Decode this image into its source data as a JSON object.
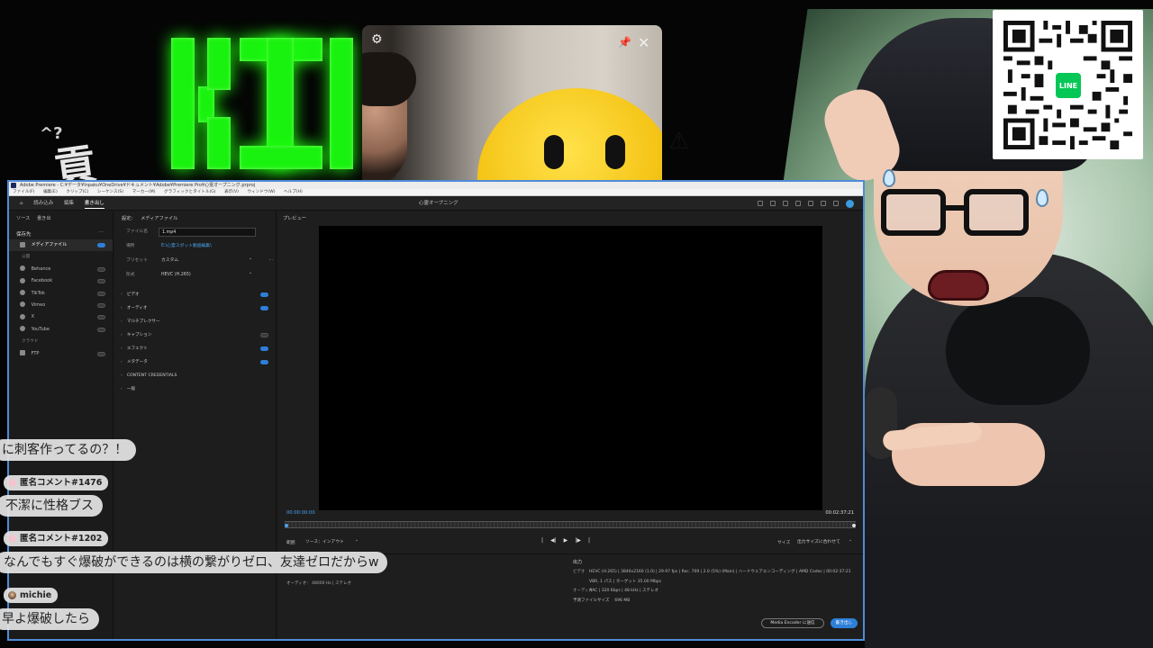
{
  "premiere": {
    "title_bar": "Adobe Premiere - C:¥データ¥Inpaku¥OneDrive¥ドキュメント¥Adobe¥Premiere Pro¥心霊オープニング.prproj",
    "menu": [
      "ファイル(F)",
      "編集(E)",
      "クリップ(C)",
      "シーケンス(S)",
      "マーカー(M)",
      "グラフィックとタイトル(G)",
      "表示(V)",
      "ウィンドウ(W)",
      "ヘルプ(H)"
    ],
    "nav": {
      "home": "⌂",
      "import": "読み込み",
      "edit": "編集",
      "export": "書き出し"
    },
    "project_name": "心霊オープニング",
    "left": {
      "source_label": "ソース",
      "source_value": "書き出",
      "destinations_label": "保存先",
      "media_file": "メディアファイル",
      "public_label": "公開",
      "platforms": [
        "Behance",
        "Facebook",
        "TikTok",
        "Vimeo",
        "X",
        "YouTube"
      ],
      "cloud_label": "クラウド",
      "ftp": "FTP"
    },
    "settings": {
      "header": "設定：",
      "header_sub": "メディアファイル",
      "file_label": "ファイル名",
      "file_value": "1.mp4",
      "location_label": "場所",
      "location_value": "E:\\心霊スポット動画編集\\",
      "preset_label": "プリセット",
      "preset_value": "カスタム",
      "format_label": "形式",
      "format_value": "HEVC (H.265)",
      "sections": [
        "ビデオ",
        "オーディオ",
        "マルチプレクサー",
        "キャプション",
        "エフェクト",
        "メタデータ",
        "CONTENT CREDENTIALS",
        "一般"
      ]
    },
    "preview": {
      "header": "プレビュー",
      "timecode_in": "00:00:00:00",
      "timecode_out": "00:02:37:21",
      "range_label": "範囲",
      "range_value": "ソース：インアウト",
      "transport": [
        "|",
        "◀|",
        "▶",
        "|▶",
        "|"
      ],
      "scale_label": "サイズ",
      "scale_value": "出力サイズに合わせて",
      "summary_label": "出力",
      "summary": [
        {
          "key": "ビデオ",
          "value": "HEVC (H.265) | 3840x2160 (1.0) | 29.97 fps | Rec. 709 | 2.0 (5%) (Main) | ハードウェアエンコーディング | AMD Codec | 00:02:37:21"
        },
        {
          "key": "",
          "value": "VBR, 1 パス | ターゲット 35.00 Mbps"
        },
        {
          "key": "オーディオ",
          "value": "AAC | 320 Kbps | 48 kHz | ステレオ"
        },
        {
          "key": "予測ファイルサイズ",
          "value": "696 MB"
        }
      ],
      "audio_src": "オーディオ： 48000 Hz | ステレオ",
      "send_to_encoder": "Media Encoder に送信",
      "export_btn": "書き出し"
    }
  },
  "chat": [
    {
      "type": "bubble",
      "text": "に刺客作ってるの？！"
    },
    {
      "type": "name",
      "text": "匿名コメント#1476"
    },
    {
      "type": "bubble",
      "text": "不潔に性格ブス"
    },
    {
      "type": "name",
      "text": "匿名コメント#1202"
    },
    {
      "type": "bubble",
      "text": "なんでもすぐ爆破ができるのは横の繋がりゼロ、友達ゼロだからw"
    },
    {
      "type": "name",
      "text": "michie"
    },
    {
      "type": "bubble",
      "text": "早よ爆破したら"
    }
  ],
  "overlay": {
    "bg_kanji": "貢",
    "bg_marks": "^?",
    "qr_badge": "LINE"
  },
  "colors": {
    "accent_blue": "#2e7fd8",
    "neon_green": "#19f20f",
    "window_border": "#4f8bd6"
  }
}
